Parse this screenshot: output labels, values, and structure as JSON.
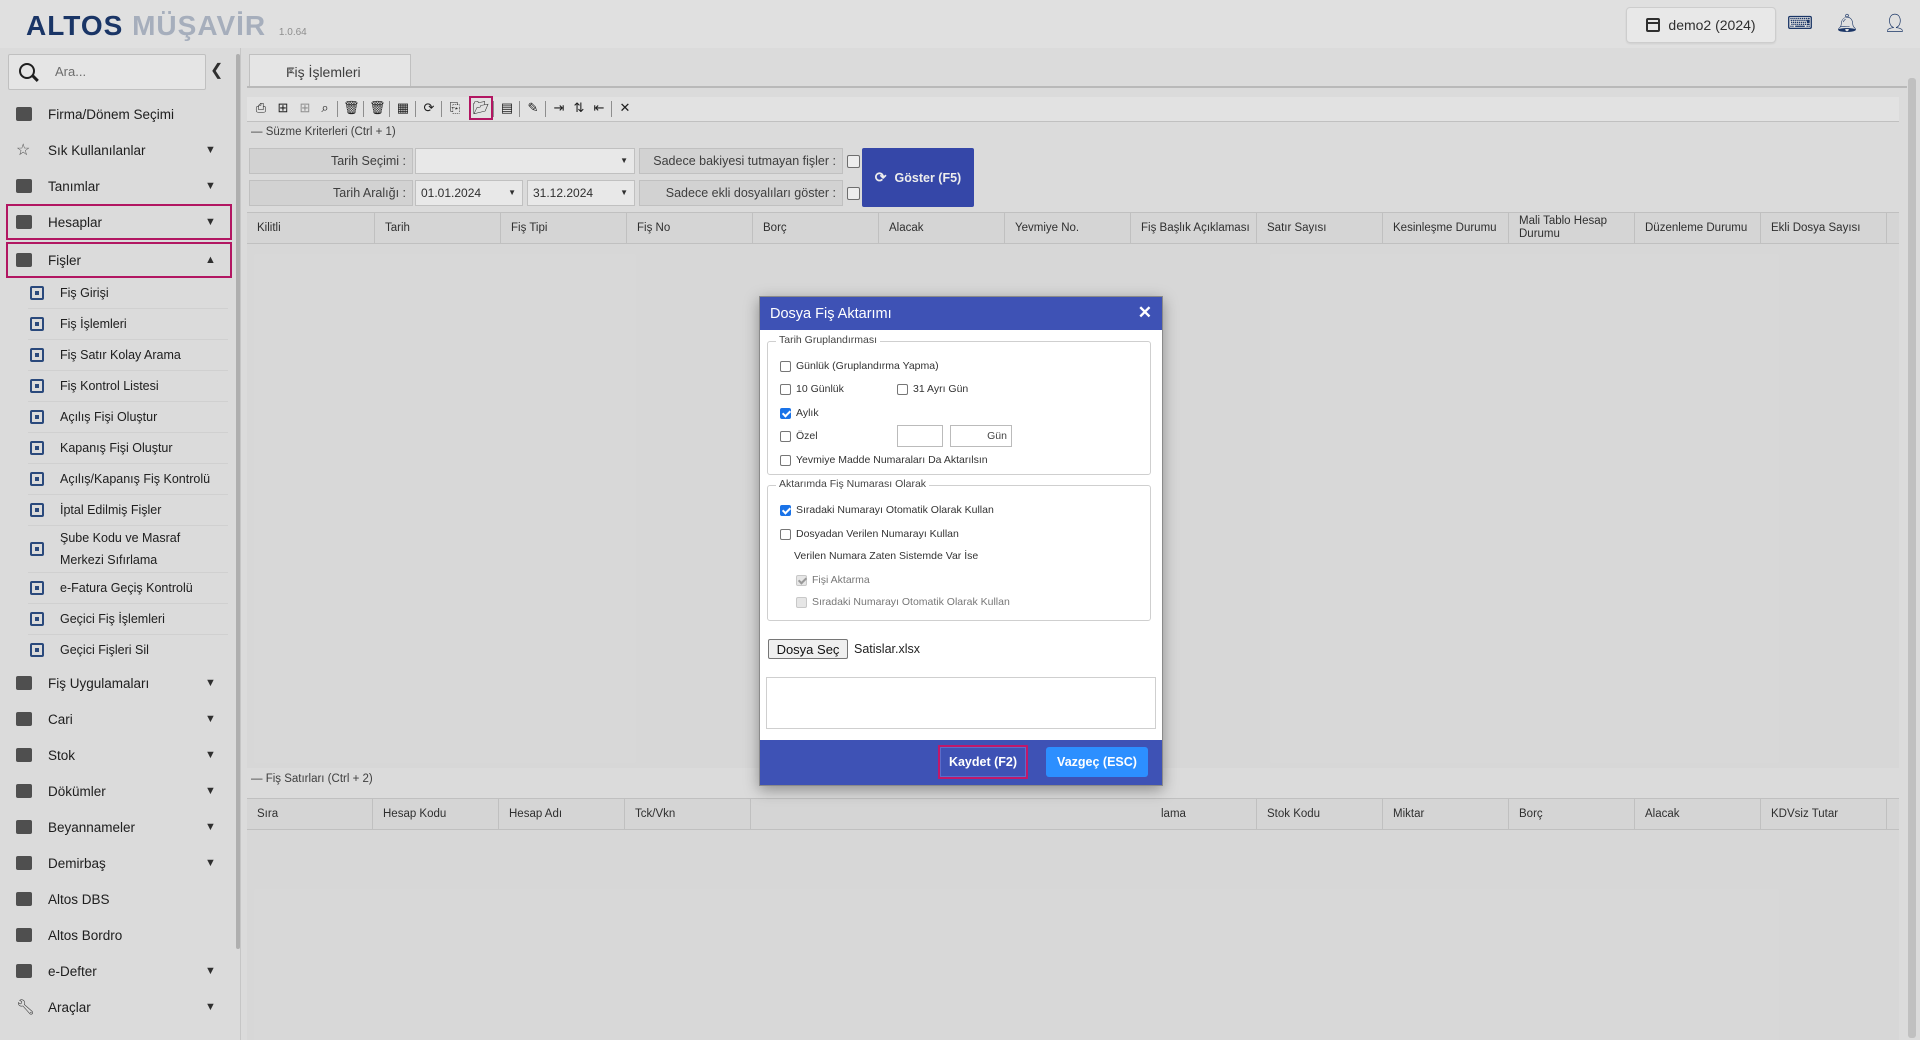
{
  "app": {
    "brand_primary": "ALTOS",
    "brand_secondary": "MÜŞAVİR",
    "version": "1.0.64",
    "period": "demo2 (2024)"
  },
  "sidebar": {
    "search_placeholder": "Ara...",
    "items": [
      {
        "label": "Firma/Dönem Seçimi"
      },
      {
        "label": "Sık Kullanılanlar"
      },
      {
        "label": "Tanımlar"
      },
      {
        "label": "Hesaplar"
      },
      {
        "label": "Fişler"
      }
    ],
    "sub_items": [
      {
        "label": "Fiş Girişi"
      },
      {
        "label": "Fiş İşlemleri"
      },
      {
        "label": "Fiş Satır Kolay Arama"
      },
      {
        "label": "Fiş Kontrol Listesi"
      },
      {
        "label": "Açılış Fişi Oluştur"
      },
      {
        "label": "Kapanış Fişi Oluştur"
      },
      {
        "label": "Açılış/Kapanış Fiş Kontrolü"
      },
      {
        "label": "İptal Edilmiş Fişler"
      },
      {
        "label": "Şube Kodu ve Masraf Merkezi Sıfırlama"
      },
      {
        "label": "e-Fatura Geçiş Kontrolü"
      },
      {
        "label": "Geçici Fiş İşlemleri"
      },
      {
        "label": "Geçici Fişleri Sil"
      }
    ],
    "items_after": [
      {
        "label": "Fiş Uygulamaları"
      },
      {
        "label": "Cari"
      },
      {
        "label": "Stok"
      },
      {
        "label": "Dökümler"
      },
      {
        "label": "Beyannameler"
      },
      {
        "label": "Demirbaş"
      },
      {
        "label": "Altos DBS"
      },
      {
        "label": "Altos Bordro"
      },
      {
        "label": "e-Defter"
      },
      {
        "label": "Araçlar"
      }
    ]
  },
  "main": {
    "tab_label": "Fiş İşlemleri",
    "filter_section": "Süzme Kriterleri (Ctrl + 1)",
    "date_selection_label": "Tarih Seçimi :",
    "date_range_label": "Tarih Aralığı :",
    "date_from": "01.01.2024",
    "date_to": "31.12.2024",
    "unbalanced_label": "Sadece bakiyesi tutmayan fişler :",
    "attached_label": "Sadece ekli dosyalıları göster :",
    "show_button": "Göster (F5)",
    "grid1_headers": [
      "Kilitli",
      "Tarih",
      "Fiş Tipi",
      "Fiş No",
      "Borç",
      "Alacak",
      "Yevmiye No.",
      "Fiş Başlık Açıklaması",
      "Satır Sayısı",
      "Kesinleşme Durumu",
      "Mali Tablo Hesap Durumu",
      "Düzenleme Durumu",
      "Ekli Dosya Sayısı"
    ],
    "lines_section": "Fiş Satırları (Ctrl + 2)",
    "grid2_headers": [
      "Sıra",
      "Hesap Kodu",
      "Hesap Adı",
      "Tck/Vkn",
      "lama",
      "Stok Kodu",
      "Miktar",
      "Borç",
      "Alacak",
      "KDVsiz Tutar"
    ]
  },
  "dialog": {
    "title": "Dosya Fiş Aktarımı",
    "group1_legend": "Tarih Gruplandırması",
    "opt_daily": "Günlük (Gruplandırma Yapma)",
    "opt_10day": "10 Günlük",
    "opt_31day": "31 Ayrı Gün",
    "opt_monthly": "Aylık",
    "opt_custom": "Özel",
    "day_unit": "Gün",
    "opt_yevmiye": "Yevmiye Madde Numaraları Da Aktarılsın",
    "group2_legend": "Aktarımda Fiş Numarası Olarak",
    "opt_next_number": "Sıradaki Numarayı Otomatik Olarak Kullan",
    "opt_file_number": "Dosyadan Verilen Numarayı Kullan",
    "exists_label": "Verilen Numara Zaten Sistemde Var İse",
    "opt_skip": "Fişi Aktarma",
    "opt_next_number2": "Sıradaki Numarayı Otomatik Olarak Kullan",
    "file_button": "Dosya Seç",
    "file_name": "Satislar.xlsx",
    "save_button": "Kaydet (F2)",
    "cancel_button": "Vazgeç (ESC)"
  }
}
